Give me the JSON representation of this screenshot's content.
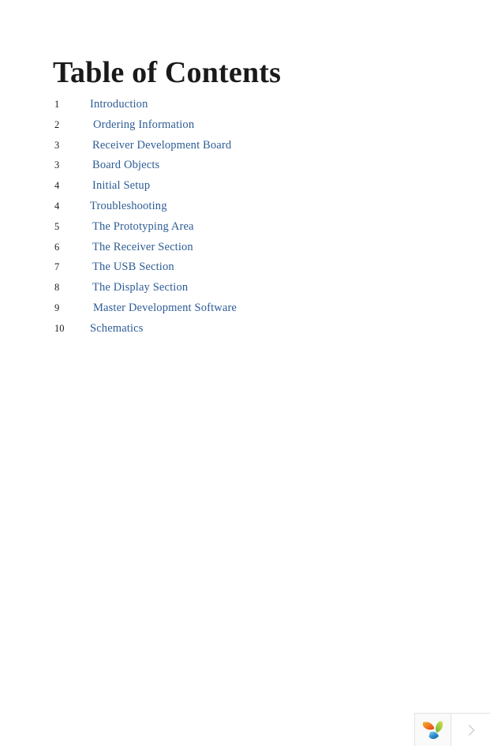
{
  "document": {
    "title": "Table of Contents",
    "background_color": "#ffffff",
    "link_color": "#2d5c96",
    "text_color": "#1c1c1c"
  },
  "toc": {
    "entries": [
      {
        "page": "1",
        "label": "Introduction"
      },
      {
        "page": "2",
        "label": "Ordering Information"
      },
      {
        "page": "3",
        "label": "Receiver Development Board"
      },
      {
        "page": "3",
        "label": "Board Objects"
      },
      {
        "page": "4",
        "label": "Initial Setup"
      },
      {
        "page": "4",
        "label": "Troubleshooting"
      },
      {
        "page": "5",
        "label": "The Prototyping Area"
      },
      {
        "page": "6",
        "label": "The Receiver Section"
      },
      {
        "page": "7",
        "label": "The USB Section"
      },
      {
        "page": "8",
        "label": "The Display Section"
      },
      {
        "page": "9",
        "label": "Master Development Software"
      },
      {
        "page": "10",
        "label": "Schematics"
      }
    ]
  },
  "corner_widget": {
    "logo_icon": "three-petal-leaf-logo-icon",
    "next_icon": "chevron-right-icon",
    "colors": {
      "petal_orange": "#e8541f",
      "petal_orange_light": "#f5a623",
      "petal_green": "#8cc63e",
      "petal_green_light": "#c3d94e",
      "petal_blue": "#1f7fc4",
      "petal_blue_light": "#5fb8e8",
      "chevron": "#cfcfcf",
      "border": "#e2e2e2"
    }
  }
}
